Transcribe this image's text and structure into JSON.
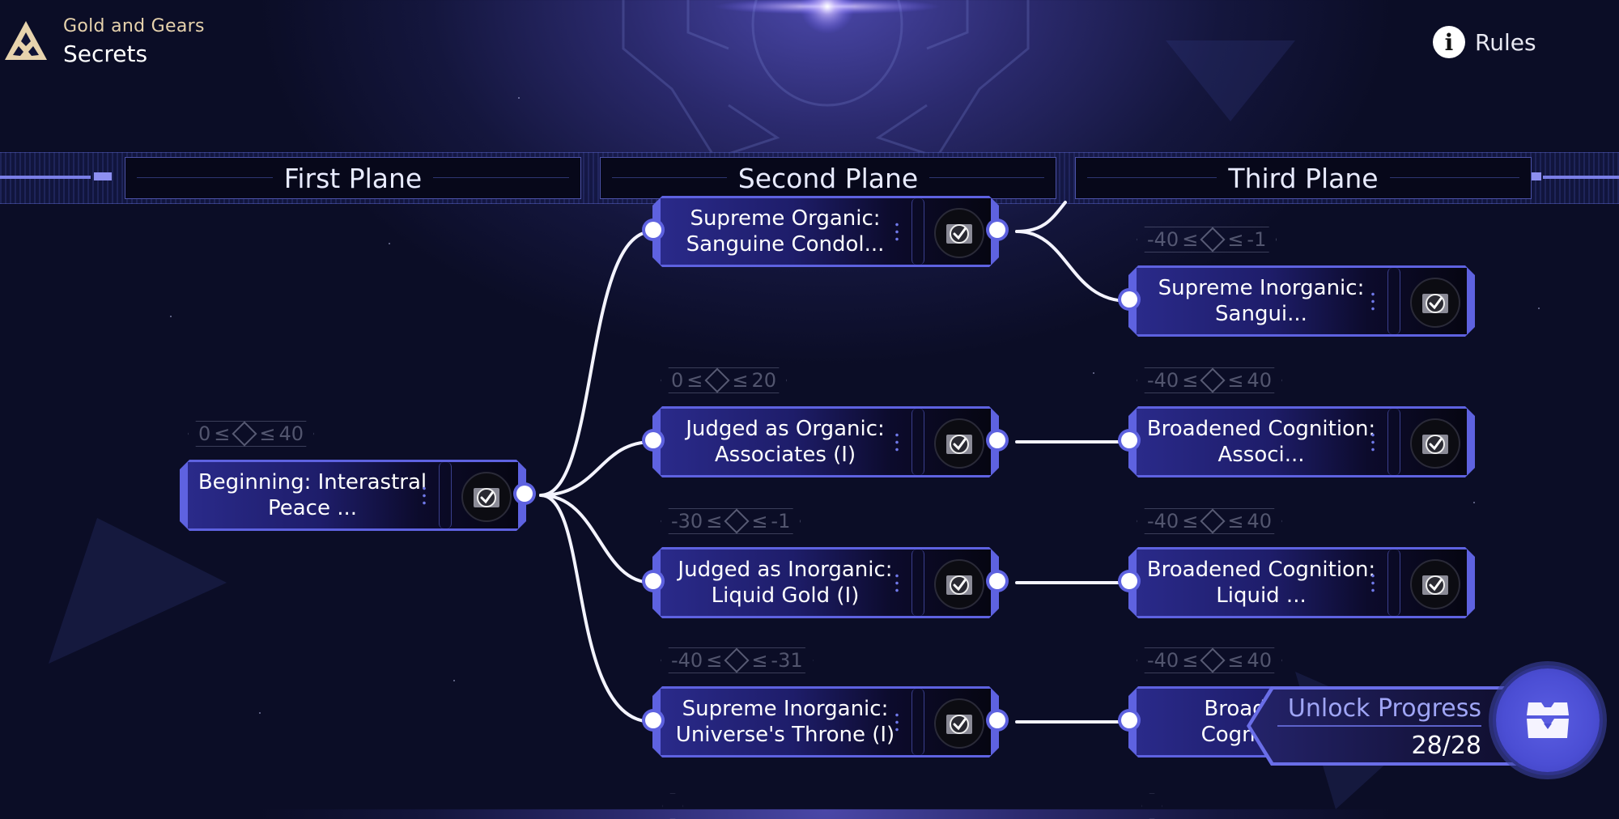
{
  "header": {
    "subtitle": "Gold and Gears",
    "title": "Secrets",
    "logo_icon": "triangle-emblem-icon",
    "rules_icon": "info-icon",
    "rules_label": "Rules"
  },
  "planes": [
    {
      "label": "First Plane"
    },
    {
      "label": "Second Plane"
    },
    {
      "label": "Third Plane"
    }
  ],
  "nodes": [
    {
      "id": "beginning",
      "title": "Beginning: Interastral Peace ...",
      "condition": {
        "min": "0",
        "max": "40"
      },
      "completed": true
    },
    {
      "id": "supreme-organic",
      "title": "Supreme Organic: Sanguine Condol...",
      "condition": null,
      "completed": true
    },
    {
      "id": "judged-organic",
      "title": "Judged as Organic: Associates (I)",
      "condition": {
        "min": "0",
        "max": "20"
      },
      "completed": true
    },
    {
      "id": "judged-inorganic",
      "title": "Judged as Inorganic: Liquid Gold (I)",
      "condition": {
        "min": "-30",
        "max": "-1"
      },
      "completed": true
    },
    {
      "id": "supreme-inorganic-throne",
      "title": "Supreme Inorganic: Universe's Throne (I)",
      "condition": {
        "min": "-40",
        "max": "-31"
      },
      "completed": true
    },
    {
      "id": "supreme-inorganic-sangui",
      "title": "Supreme Inorganic: Sangui...",
      "condition": {
        "min": "-40",
        "max": "-1"
      },
      "completed": true
    },
    {
      "id": "broadened-associ",
      "title": "Broadened Cognition: Associ...",
      "condition": {
        "min": "-40",
        "max": "40"
      },
      "completed": true
    },
    {
      "id": "broadened-liquid",
      "title": "Broadened Cognition: Liquid ...",
      "condition": {
        "min": "-40",
        "max": "40"
      },
      "completed": true
    },
    {
      "id": "broadened-partial",
      "title": "Broadened Cognition...",
      "condition": {
        "min": "-40",
        "max": "40"
      },
      "completed": true
    }
  ],
  "condition_symbol": "≤",
  "progress": {
    "label": "Unlock Progress",
    "count_text": "28/28",
    "unlocked": 28,
    "total": 28,
    "chest_icon": "chest-icon"
  },
  "colors": {
    "accent": "#5e62e0",
    "header_gold": "#e7d3ad",
    "progress_label": "#9fa5f5"
  }
}
